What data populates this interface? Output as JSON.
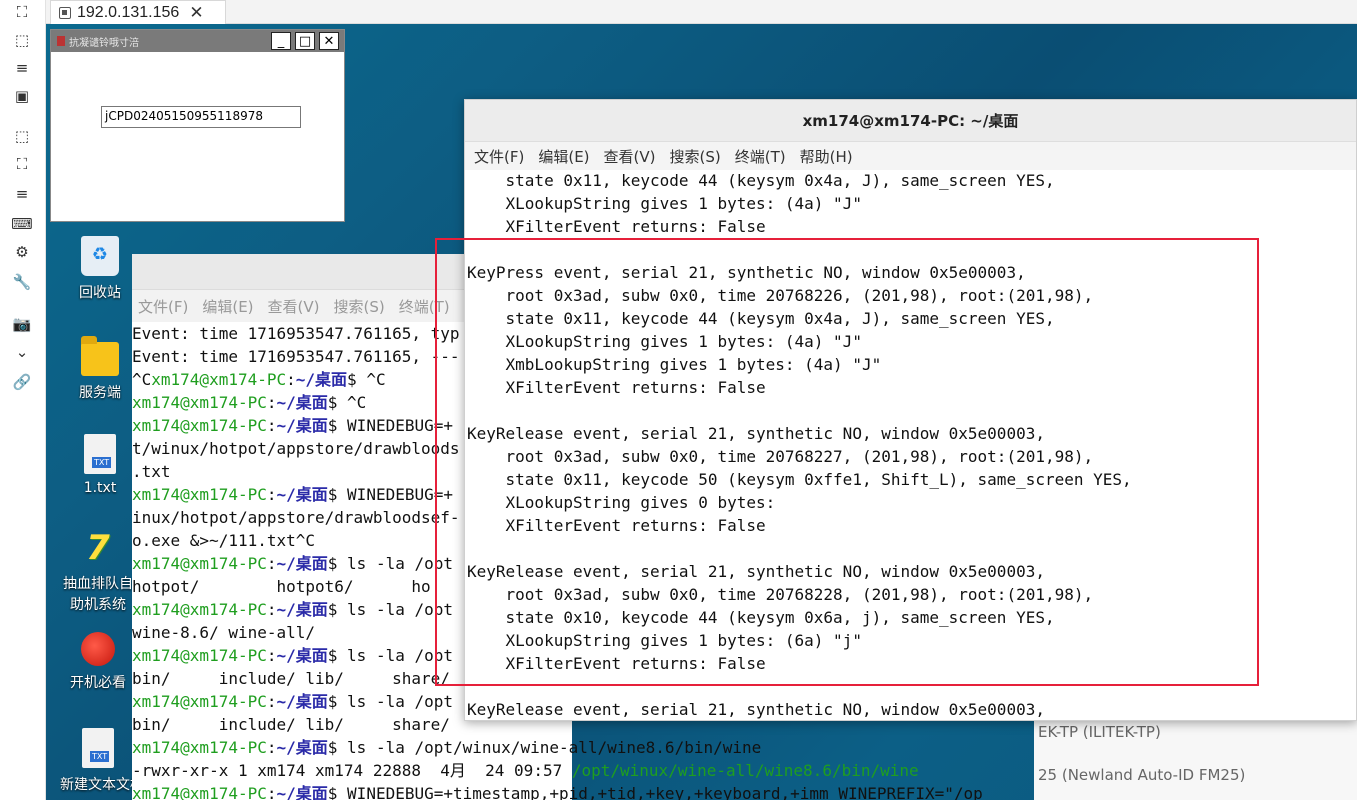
{
  "toolbar": {
    "icons": [
      "expand-icon",
      "fullscreen-icon",
      "menu-icon",
      "window-icon",
      "select-icon",
      "fit-icon",
      "list-icon",
      "keyboard-icon",
      "settings-icon",
      "wrench-icon",
      "camera-icon",
      "chevron-down-icon",
      "link-icon"
    ],
    "glyphs": [
      "⛶",
      "⬚",
      "≡",
      "▣",
      "⬚",
      "⛶",
      "≡",
      "⌨",
      "⚙",
      "🔧",
      "📷",
      "⌄",
      "🔗"
    ]
  },
  "tab": {
    "title": "192.0.131.156",
    "close": "✕"
  },
  "desktop_icons": [
    {
      "label": "回收站"
    },
    {
      "label": "服务端"
    },
    {
      "label": "1.txt"
    },
    {
      "label": "抽血排队自助机系统"
    },
    {
      "label": "开机必看"
    },
    {
      "label": "新建文本文档"
    }
  ],
  "wine_window": {
    "title": "抗凝谴铃哦寸涪",
    "min": "_",
    "max": "□",
    "close": "✕",
    "field_value": "jCPD02405150955118978"
  },
  "back_terminal": {
    "menu": [
      "文件(F)",
      "编辑(E)",
      "查看(V)",
      "搜索(S)",
      "终端(T)"
    ],
    "lines": [
      [
        {
          "t": "Event: time 1716953547.761165, typ"
        }
      ],
      [
        {
          "t": "Event: time 1716953547.761165, ---"
        }
      ],
      [
        {
          "t": "^C"
        },
        {
          "t": "xm174@xm174-PC",
          "c": "prompt"
        },
        {
          "t": ":"
        },
        {
          "t": "~/桌面",
          "c": "dir"
        },
        {
          "t": "$ ^C"
        }
      ],
      [
        {
          "t": "xm174@xm174-PC",
          "c": "prompt"
        },
        {
          "t": ":"
        },
        {
          "t": "~/桌面",
          "c": "dir"
        },
        {
          "t": "$ ^C"
        }
      ],
      [
        {
          "t": "xm174@xm174-PC",
          "c": "prompt"
        },
        {
          "t": ":"
        },
        {
          "t": "~/桌面",
          "c": "dir"
        },
        {
          "t": "$ WINEDEBUG=+"
        }
      ],
      [
        {
          "t": "t/winux/hotpot/appstore/drawbloods"
        }
      ],
      [
        {
          "t": ".txt"
        }
      ],
      [
        {
          "t": "xm174@xm174-PC",
          "c": "prompt"
        },
        {
          "t": ":"
        },
        {
          "t": "~/桌面",
          "c": "dir"
        },
        {
          "t": "$ WINEDEBUG=+"
        }
      ],
      [
        {
          "t": "inux/hotpot/appstore/drawbloodsef-"
        }
      ],
      [
        {
          "t": "o.exe &>~/111.txt^C"
        }
      ],
      [
        {
          "t": "xm174@xm174-PC",
          "c": "prompt"
        },
        {
          "t": ":"
        },
        {
          "t": "~/桌面",
          "c": "dir"
        },
        {
          "t": "$ ls -la /opt"
        }
      ],
      [
        {
          "t": "hotpot/        hotpot6/      ho"
        }
      ],
      [
        {
          "t": "xm174@xm174-PC",
          "c": "prompt"
        },
        {
          "t": ":"
        },
        {
          "t": "~/桌面",
          "c": "dir"
        },
        {
          "t": "$ ls -la /opt"
        }
      ],
      [
        {
          "t": "wine-8.6/ wine-all/"
        }
      ],
      [
        {
          "t": "xm174@xm174-PC",
          "c": "prompt"
        },
        {
          "t": ":"
        },
        {
          "t": "~/桌面",
          "c": "dir"
        },
        {
          "t": "$ ls -la /opt"
        }
      ],
      [
        {
          "t": "bin/     include/ lib/     share/"
        }
      ],
      [
        {
          "t": "xm174@xm174-PC",
          "c": "prompt"
        },
        {
          "t": ":"
        },
        {
          "t": "~/桌面",
          "c": "dir"
        },
        {
          "t": "$ ls -la /opt"
        }
      ],
      [
        {
          "t": "bin/     include/ lib/     share/"
        }
      ],
      [
        {
          "t": "xm174@xm174-PC",
          "c": "prompt"
        },
        {
          "t": ":"
        },
        {
          "t": "~/桌面",
          "c": "dir"
        },
        {
          "t": "$ ls -la /opt/winux/wine-all/wine8.6/bin/wine"
        }
      ],
      [
        {
          "t": "-rwxr-xr-x 1 xm174 xm174 22888  4月  24 09:57 "
        },
        {
          "t": "/opt/winux/wine-all/wine8.6/bin/wine",
          "c": "path"
        }
      ],
      [
        {
          "t": "xm174@xm174-PC",
          "c": "prompt"
        },
        {
          "t": ":"
        },
        {
          "t": "~/桌面",
          "c": "dir"
        },
        {
          "t": "$ WINEDEBUG=+timestamp,+pid,+tid,+key,+keyboard,+imm WINEPREFIX=\"/op"
        }
      ]
    ]
  },
  "device_list": [
    "EK-TP (ILITEK-TP)",
    "25 (Newland Auto-ID FM25)"
  ],
  "front_terminal": {
    "title": "xm174@xm174-PC: ~/桌面",
    "menu": [
      "文件(F)",
      "编辑(E)",
      "查看(V)",
      "搜索(S)",
      "终端(T)",
      "帮助(H)"
    ],
    "lines": [
      "    state 0x11, keycode 44 (keysym 0x4a, J), same_screen YES,",
      "    XLookupString gives 1 bytes: (4a) \"J\"",
      "    XFilterEvent returns: False",
      "",
      "KeyPress event, serial 21, synthetic NO, window 0x5e00003,",
      "    root 0x3ad, subw 0x0, time 20768226, (201,98), root:(201,98),",
      "    state 0x11, keycode 44 (keysym 0x4a, J), same_screen YES,",
      "    XLookupString gives 1 bytes: (4a) \"J\"",
      "    XmbLookupString gives 1 bytes: (4a) \"J\"",
      "    XFilterEvent returns: False",
      "",
      "KeyRelease event, serial 21, synthetic NO, window 0x5e00003,",
      "    root 0x3ad, subw 0x0, time 20768227, (201,98), root:(201,98),",
      "    state 0x11, keycode 50 (keysym 0xffe1, Shift_L), same_screen YES,",
      "    XLookupString gives 0 bytes:",
      "    XFilterEvent returns: False",
      "",
      "KeyRelease event, serial 21, synthetic NO, window 0x5e00003,",
      "    root 0x3ad, subw 0x0, time 20768228, (201,98), root:(201,98),",
      "    state 0x10, keycode 44 (keysym 0x6a, j), same_screen YES,",
      "    XLookupString gives 1 bytes: (6a) \"j\"",
      "    XFilterEvent returns: False",
      "",
      "KeyRelease event, serial 21, synthetic NO, window 0x5e00003,"
    ]
  },
  "colors": {
    "highlight": "#e6203a",
    "prompt": "#1f9e1f",
    "dir": "#2a2aa8"
  }
}
